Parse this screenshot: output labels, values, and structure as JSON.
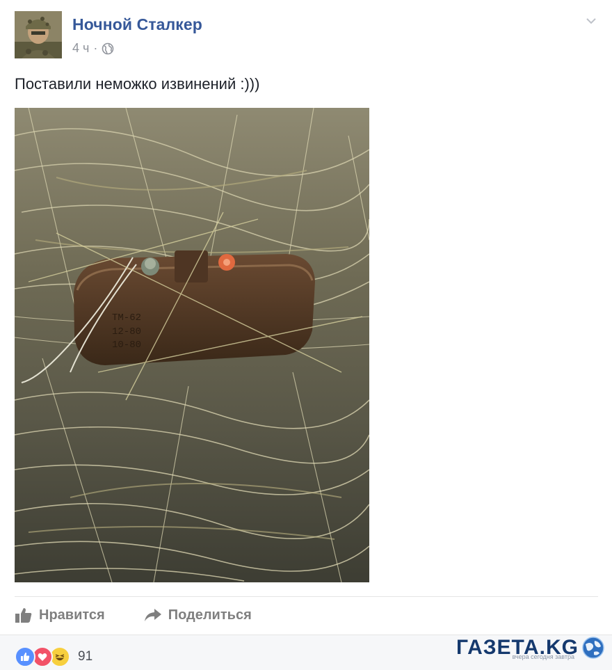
{
  "post": {
    "author_name": "Ночной Сталкер",
    "timestamp": "4 ч",
    "separator": "·",
    "privacy_icon": "globe-icon",
    "text": "Поставили неможко извинений :)))"
  },
  "actions": {
    "like_label": "Нравится",
    "share_label": "Поделиться"
  },
  "reactions": {
    "types": [
      "like",
      "love",
      "haha"
    ],
    "count": "91"
  },
  "watermark": {
    "title": "ГАЗЕТА.KG",
    "tagline": "вчера сегодня завтра"
  },
  "colors": {
    "author_link": "#365899",
    "meta_gray": "#90949c",
    "action_gray": "#7f7f7f",
    "like_blue": "#5890ff",
    "love_red": "#f25268",
    "haha_yellow": "#f7cf3e"
  }
}
